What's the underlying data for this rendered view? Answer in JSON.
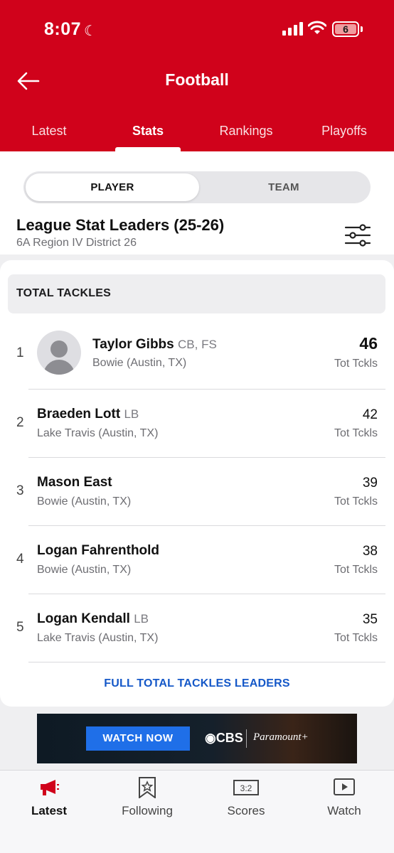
{
  "status_bar": {
    "time": "8:07",
    "battery": "6"
  },
  "header": {
    "title": "Football",
    "tabs": [
      {
        "label": "Latest"
      },
      {
        "label": "Stats"
      },
      {
        "label": "Rankings"
      },
      {
        "label": "Playoffs"
      }
    ],
    "active_tab": "Stats"
  },
  "segmented": {
    "player": "PLAYER",
    "team": "TEAM",
    "selected": "PLAYER"
  },
  "league": {
    "title": "League Stat Leaders (25-26)",
    "subtitle": "6A Region IV District 26"
  },
  "leaders": {
    "category": "TOTAL TACKLES",
    "rows": [
      {
        "rank": "1",
        "name": "Taylor Gibbs",
        "positions": "CB, FS",
        "school": "Bowie (Austin, TX)",
        "value": "46",
        "unit": "Tot Tckls"
      },
      {
        "rank": "2",
        "name": "Braeden Lott",
        "positions": "LB",
        "school": "Lake Travis (Austin, TX)",
        "value": "42",
        "unit": "Tot Tckls"
      },
      {
        "rank": "3",
        "name": "Mason East",
        "positions": "",
        "school": "Bowie (Austin, TX)",
        "value": "39",
        "unit": "Tot Tckls"
      },
      {
        "rank": "4",
        "name": "Logan Fahrenthold",
        "positions": "",
        "school": "Bowie (Austin, TX)",
        "value": "38",
        "unit": "Tot Tckls"
      },
      {
        "rank": "5",
        "name": "Logan Kendall",
        "positions": "LB",
        "school": "Lake Travis (Austin, TX)",
        "value": "35",
        "unit": "Tot Tckls"
      }
    ],
    "full_link": "FULL TOTAL TACKLES LEADERS"
  },
  "ad": {
    "button": "WATCH NOW",
    "brand": "CBS",
    "partner": "Paramount+"
  },
  "bottom_nav": {
    "items": [
      {
        "label": "Latest",
        "icon": "megaphone-icon"
      },
      {
        "label": "Following",
        "icon": "bookmark-star-icon"
      },
      {
        "label": "Scores",
        "icon": "scoreboard-icon"
      },
      {
        "label": "Watch",
        "icon": "play-icon"
      }
    ],
    "active": "Latest"
  },
  "colors": {
    "brand_red": "#d0021b",
    "link_blue": "#1558c8",
    "ad_button_blue": "#1f6fe8"
  }
}
